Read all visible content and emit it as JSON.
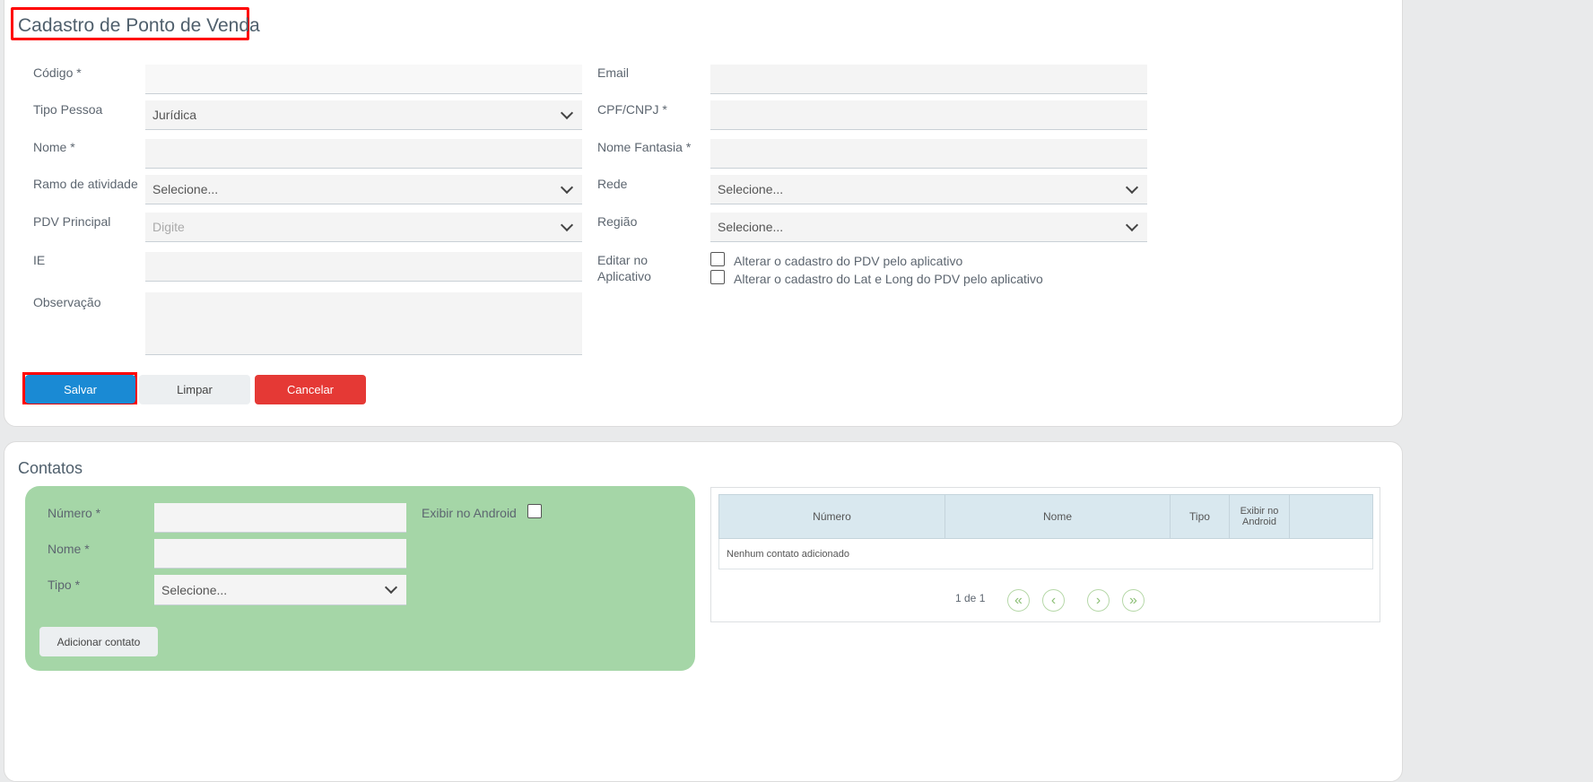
{
  "form": {
    "title": "Cadastro de Ponto de Venda",
    "left": [
      {
        "label": "Código *",
        "value": ""
      },
      {
        "label": "Tipo Pessoa",
        "value": "Jurídica"
      },
      {
        "label": "Nome *",
        "value": ""
      },
      {
        "label": "Ramo de atividade",
        "value": "Selecione..."
      },
      {
        "label": "PDV Principal",
        "placeholder": "Digite"
      },
      {
        "label": "IE",
        "value": ""
      },
      {
        "label": "Observação",
        "value": ""
      }
    ],
    "right": [
      {
        "label": "Email",
        "value": ""
      },
      {
        "label": "CPF/CNPJ *",
        "value": ""
      },
      {
        "label": "Nome Fantasia *",
        "value": ""
      },
      {
        "label": "Rede",
        "value": "Selecione..."
      },
      {
        "label": "Região",
        "value": "Selecione..."
      }
    ],
    "edit_label_1": "Editar no",
    "edit_label_2": "Aplicativo",
    "checkbox_1": "Alterar o cadastro do PDV pelo aplicativo",
    "checkbox_2": "Alterar o cadastro do Lat e Long do PDV pelo aplicativo",
    "buttons": {
      "save": "Salvar",
      "clear": "Limpar",
      "cancel": "Cancelar"
    }
  },
  "contacts": {
    "title": "Contatos",
    "numero_label": "Número *",
    "nome_label": "Nome *",
    "tipo_label": "Tipo *",
    "tipo_value": "Selecione...",
    "android_label": "Exibir no Android",
    "add_button": "Adicionar contato",
    "table": {
      "headers": [
        "Número",
        "Nome",
        "Tipo",
        "Exibir no Android",
        ""
      ],
      "empty": "Nenhum contato adicionado"
    },
    "pagination": {
      "text": "1 de 1"
    }
  },
  "colors": {
    "primary": "#1a8ad4",
    "danger": "#e53935",
    "panel": "#a5d6a7",
    "highlight": "#ff0000"
  }
}
